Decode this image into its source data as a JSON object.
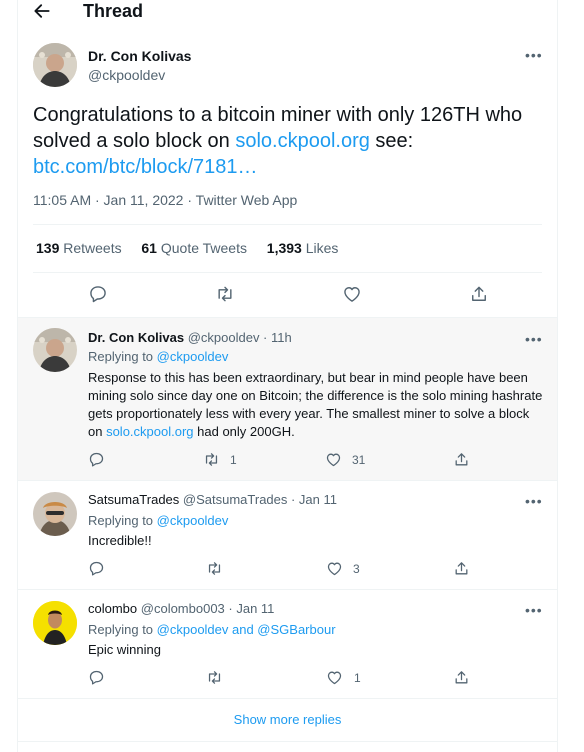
{
  "header": {
    "title": "Thread"
  },
  "main_tweet": {
    "author_name": "Dr. Con Kolivas",
    "author_handle": "@ckpooldev",
    "text_part1": "Congratulations to a bitcoin miner with only 126TH who solved a solo block on ",
    "text_link1": "solo.ckpool.org",
    "text_part2": " see:",
    "text_link2": "btc.com/btc/block/7181…",
    "meta": "11:05 AM · Jan 11, 2022 · Twitter Web App",
    "stats": {
      "retweets_count": "139",
      "retweets_label": "Retweets",
      "quotes_count": "61",
      "quotes_label": "Quote Tweets",
      "likes_count": "1,393",
      "likes_label": "Likes"
    }
  },
  "replies": [
    {
      "name": "Dr. Con Kolivas",
      "handle_time": "@ckpooldev · 11h",
      "replying_prefix": "Replying to ",
      "replying_to": "@ckpooldev",
      "text_before": "Response to this has been extraordinary, but bear in mind people have been mining solo since day one on Bitcoin; the difference is the solo mining hashrate gets proportionately less with every year. The smallest miner to solve a block on ",
      "text_link": "solo.ckpool.org",
      "text_after": " had only 200GH.",
      "retweets": "1",
      "likes": "31"
    },
    {
      "name": "SatsumaTrades",
      "handle_time": "@SatsumaTrades · Jan 11",
      "replying_prefix": "Replying to ",
      "replying_to": "@ckpooldev",
      "text": "Incredible!!",
      "likes": "3"
    },
    {
      "name": "colombo",
      "handle_time": "@colombo003 · Jan 11",
      "replying_prefix": "Replying to ",
      "replying_to": "@ckpooldev and @SGBarbour",
      "text": "Epic winning",
      "likes": "1"
    }
  ],
  "show_more": "Show more replies",
  "colors": {
    "accent": "#1d9bf0",
    "muted": "#536471",
    "highlight_bg": "#f7f7f7"
  },
  "icons": [
    "back-arrow-icon",
    "more-icon",
    "reply-icon",
    "retweet-icon",
    "like-icon",
    "share-icon"
  ]
}
